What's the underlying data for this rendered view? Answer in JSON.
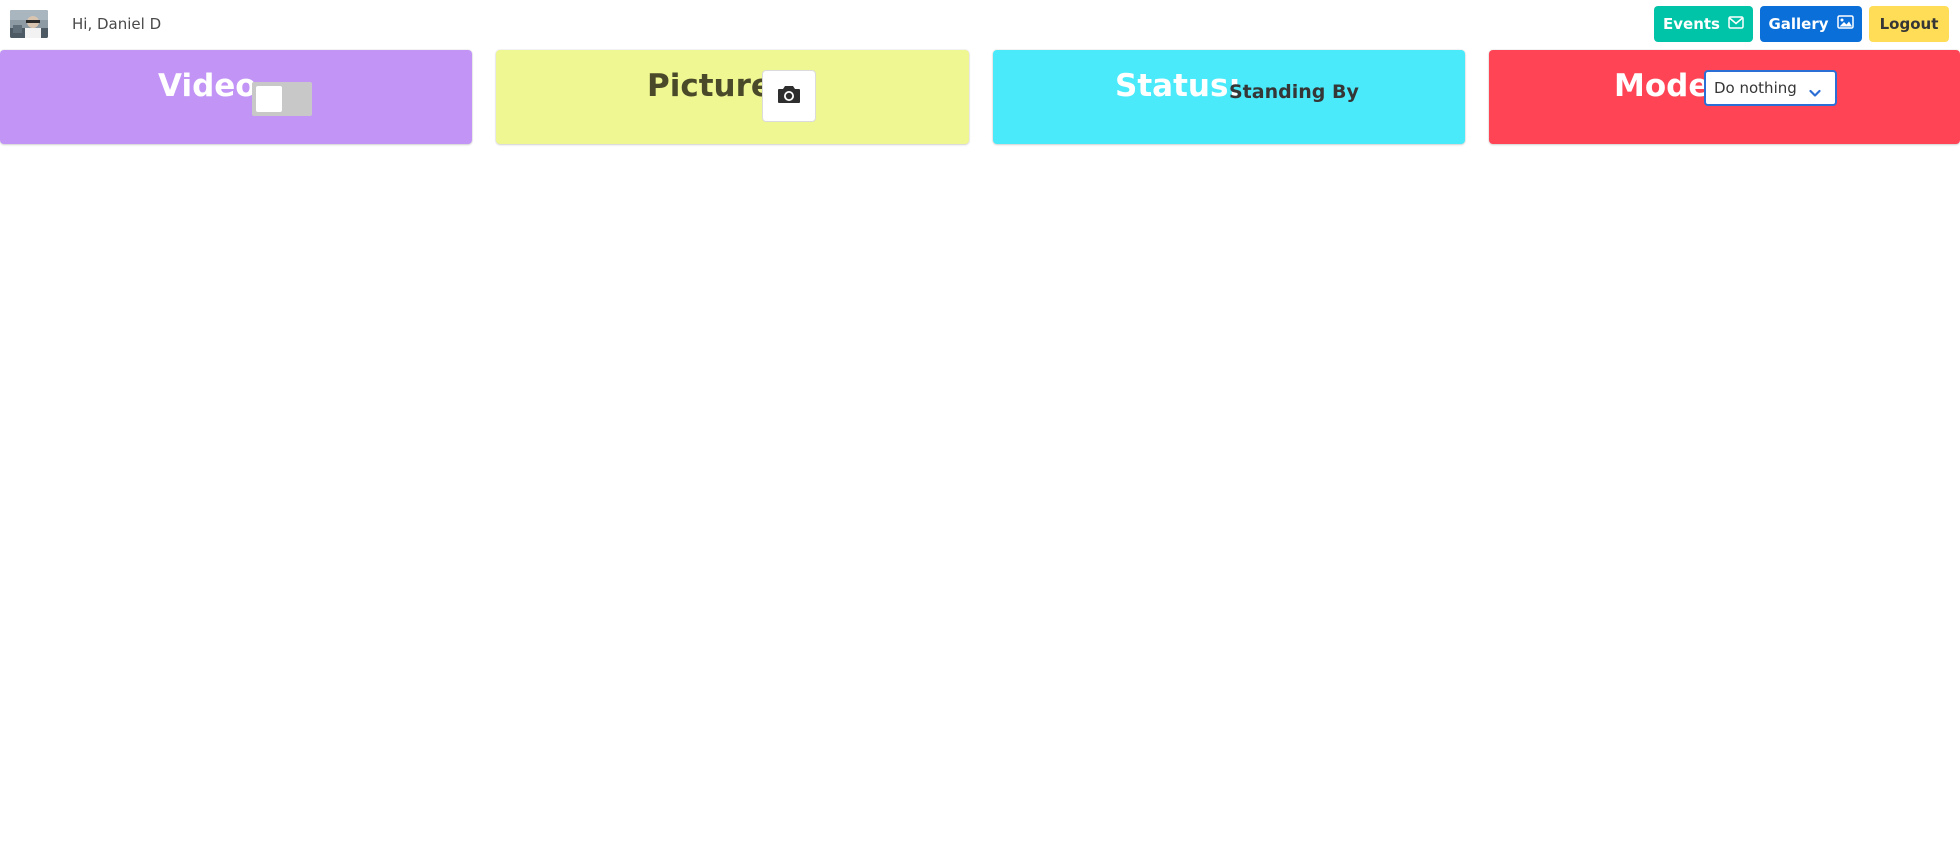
{
  "header": {
    "greeting": "Hi, Daniel D",
    "buttons": {
      "events": {
        "label": "Events",
        "icon": "envelope-icon",
        "color": "#00c4a7"
      },
      "gallery": {
        "label": "Gallery",
        "icon": "image-icon",
        "color": "#0a6fd8"
      },
      "logout": {
        "label": "Logout",
        "color": "#ffdd57"
      }
    }
  },
  "cards": {
    "video": {
      "title": "Video",
      "color": "#c194f5",
      "toggle_on": false
    },
    "picture": {
      "title": "Picture",
      "color": "#eff792",
      "icon": "camera-icon"
    },
    "status": {
      "title": "Status:",
      "value": "Standing By",
      "color": "#4aeafa"
    },
    "mode": {
      "title": "Mode",
      "selected": "Do nothing",
      "color": "#ff4455"
    }
  }
}
